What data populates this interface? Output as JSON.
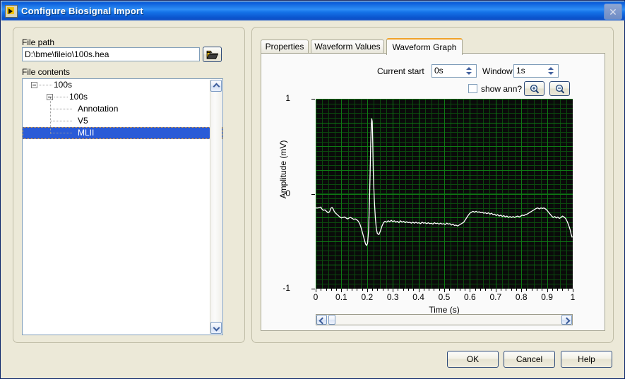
{
  "window": {
    "title": "Configure Biosignal Import",
    "icon": "labview-icon",
    "close_label": "✕"
  },
  "left_panel": {
    "file_path_label": "File path",
    "file_path_value": "D:\\bme\\fileio\\100s.hea",
    "browse_icon": "open-folder-icon",
    "file_contents_label": "File contents",
    "tree": [
      {
        "label": "100s",
        "depth": 0,
        "expander": true,
        "selected": false
      },
      {
        "label": "100s",
        "depth": 1,
        "expander": true,
        "selected": false
      },
      {
        "label": "Annotation",
        "depth": 2,
        "expander": false,
        "selected": false
      },
      {
        "label": "V5",
        "depth": 2,
        "expander": false,
        "selected": false
      },
      {
        "label": "MLII",
        "depth": 2,
        "expander": false,
        "selected": true
      }
    ]
  },
  "right_panel": {
    "tabs": [
      {
        "label": "Properties",
        "active": false
      },
      {
        "label": "Waveform Values",
        "active": false
      },
      {
        "label": "Waveform Graph",
        "active": true
      }
    ],
    "controls": {
      "current_start_label": "Current start",
      "current_start_value": "0s",
      "window_label": "Window",
      "window_value": "1s",
      "show_ann_label": "show ann?",
      "show_ann_checked": false,
      "zoom_in_icon": "magnifier-plus-icon",
      "zoom_out_icon": "magnifier-minus-icon"
    },
    "scrollbar": {
      "left_icon": "chevron-left-icon",
      "right_icon": "chevron-right-icon"
    }
  },
  "footer": {
    "ok_label": "OK",
    "cancel_label": "Cancel",
    "help_label": "Help"
  },
  "colors": {
    "titlebar_blue": "#0C5EDB",
    "dialog_face": "#ECE9D8",
    "selection_blue": "#2A5BD7",
    "tab_accent": "#F0A229",
    "plot_background": "#0A0A0A",
    "plot_grid": "#0E7A14",
    "plot_trace": "#FFFFFF"
  },
  "chart_data": {
    "type": "line",
    "title": "",
    "xlabel": "Time (s)",
    "ylabel": "Amplitude (mV)",
    "xlim": [
      0,
      1
    ],
    "ylim": [
      -1,
      1
    ],
    "xticks": [
      0,
      0.1,
      0.2,
      0.3,
      0.4,
      0.5,
      0.6,
      0.7,
      0.8,
      0.9,
      1
    ],
    "xtick_labels": [
      "0",
      "0.1",
      "0.2",
      "0.3",
      "0.4",
      "0.5",
      "0.6",
      "0.7",
      "0.8",
      "0.9",
      "1"
    ],
    "yticks": [
      -1,
      0,
      1
    ],
    "ytick_labels": [
      "-1",
      "0",
      "1"
    ],
    "grid": true,
    "grid_minor_step_x": 0.025,
    "grid_minor_step_y": 0.05,
    "grid_major_step_x": 0.1,
    "grid_major_step_y": 0.25,
    "legend": null,
    "series": [
      {
        "name": "MLII",
        "color": "#FFFFFF",
        "x": [
          0.0,
          0.008,
          0.016,
          0.02,
          0.024,
          0.03,
          0.036,
          0.042,
          0.048,
          0.054,
          0.06,
          0.064,
          0.068,
          0.072,
          0.076,
          0.082,
          0.088,
          0.094,
          0.1,
          0.106,
          0.112,
          0.118,
          0.124,
          0.13,
          0.136,
          0.142,
          0.148,
          0.154,
          0.16,
          0.166,
          0.172,
          0.178,
          0.184,
          0.19,
          0.194,
          0.198,
          0.202,
          0.206,
          0.208,
          0.21,
          0.212,
          0.214,
          0.216,
          0.218,
          0.22,
          0.222,
          0.224,
          0.228,
          0.232,
          0.236,
          0.24,
          0.246,
          0.252,
          0.258,
          0.264,
          0.27,
          0.276,
          0.282,
          0.288,
          0.294,
          0.3,
          0.306,
          0.312,
          0.318,
          0.324,
          0.33,
          0.336,
          0.342,
          0.348,
          0.354,
          0.36,
          0.366,
          0.372,
          0.378,
          0.384,
          0.39,
          0.396,
          0.402,
          0.408,
          0.414,
          0.42,
          0.426,
          0.432,
          0.438,
          0.444,
          0.45,
          0.456,
          0.462,
          0.468,
          0.474,
          0.48,
          0.486,
          0.492,
          0.498,
          0.504,
          0.51,
          0.516,
          0.522,
          0.528,
          0.534,
          0.54,
          0.546,
          0.552,
          0.558,
          0.564,
          0.57,
          0.576,
          0.582,
          0.588,
          0.594,
          0.6,
          0.606,
          0.612,
          0.618,
          0.624,
          0.63,
          0.636,
          0.642,
          0.648,
          0.654,
          0.66,
          0.666,
          0.672,
          0.678,
          0.684,
          0.69,
          0.696,
          0.702,
          0.708,
          0.714,
          0.72,
          0.726,
          0.732,
          0.738,
          0.744,
          0.75,
          0.756,
          0.762,
          0.768,
          0.774,
          0.78,
          0.786,
          0.792,
          0.798,
          0.804,
          0.81,
          0.816,
          0.822,
          0.828,
          0.834,
          0.84,
          0.846,
          0.852,
          0.858,
          0.864,
          0.87,
          0.876,
          0.882,
          0.888,
          0.894,
          0.9,
          0.906,
          0.912,
          0.918,
          0.924,
          0.93,
          0.936,
          0.942,
          0.948,
          0.954,
          0.96,
          0.966,
          0.972,
          0.978,
          0.984,
          0.99,
          0.994,
          0.998,
          1.0
        ],
        "y": [
          -0.15,
          -0.15,
          -0.145,
          -0.14,
          -0.16,
          -0.175,
          -0.17,
          -0.185,
          -0.2,
          -0.19,
          -0.15,
          -0.145,
          -0.16,
          -0.185,
          -0.2,
          -0.215,
          -0.23,
          -0.245,
          -0.255,
          -0.25,
          -0.245,
          -0.255,
          -0.265,
          -0.255,
          -0.25,
          -0.26,
          -0.27,
          -0.265,
          -0.275,
          -0.29,
          -0.32,
          -0.37,
          -0.43,
          -0.49,
          -0.53,
          -0.545,
          -0.52,
          -0.38,
          -0.2,
          0.0,
          0.25,
          0.52,
          0.7,
          0.79,
          0.76,
          0.54,
          0.23,
          -0.06,
          -0.25,
          -0.37,
          -0.42,
          -0.43,
          -0.39,
          -0.34,
          -0.305,
          -0.29,
          -0.3,
          -0.285,
          -0.295,
          -0.28,
          -0.295,
          -0.285,
          -0.3,
          -0.29,
          -0.305,
          -0.285,
          -0.3,
          -0.29,
          -0.305,
          -0.295,
          -0.305,
          -0.3,
          -0.31,
          -0.3,
          -0.31,
          -0.3,
          -0.31,
          -0.305,
          -0.315,
          -0.3,
          -0.31,
          -0.305,
          -0.315,
          -0.305,
          -0.315,
          -0.31,
          -0.32,
          -0.305,
          -0.315,
          -0.31,
          -0.32,
          -0.31,
          -0.32,
          -0.315,
          -0.325,
          -0.31,
          -0.32,
          -0.315,
          -0.33,
          -0.32,
          -0.335,
          -0.33,
          -0.34,
          -0.33,
          -0.32,
          -0.31,
          -0.3,
          -0.275,
          -0.25,
          -0.225,
          -0.205,
          -0.195,
          -0.185,
          -0.195,
          -0.185,
          -0.195,
          -0.19,
          -0.2,
          -0.195,
          -0.205,
          -0.2,
          -0.21,
          -0.2,
          -0.215,
          -0.205,
          -0.22,
          -0.215,
          -0.23,
          -0.22,
          -0.235,
          -0.225,
          -0.24,
          -0.23,
          -0.245,
          -0.235,
          -0.25,
          -0.24,
          -0.25,
          -0.24,
          -0.25,
          -0.24,
          -0.235,
          -0.245,
          -0.235,
          -0.225,
          -0.23,
          -0.22,
          -0.215,
          -0.205,
          -0.195,
          -0.185,
          -0.175,
          -0.165,
          -0.155,
          -0.15,
          -0.16,
          -0.15,
          -0.155,
          -0.15,
          -0.16,
          -0.175,
          -0.195,
          -0.215,
          -0.235,
          -0.25,
          -0.24,
          -0.255,
          -0.245,
          -0.26,
          -0.25,
          -0.235,
          -0.245,
          -0.26,
          -0.29,
          -0.33,
          -0.38,
          -0.43,
          -0.46
        ]
      }
    ]
  }
}
